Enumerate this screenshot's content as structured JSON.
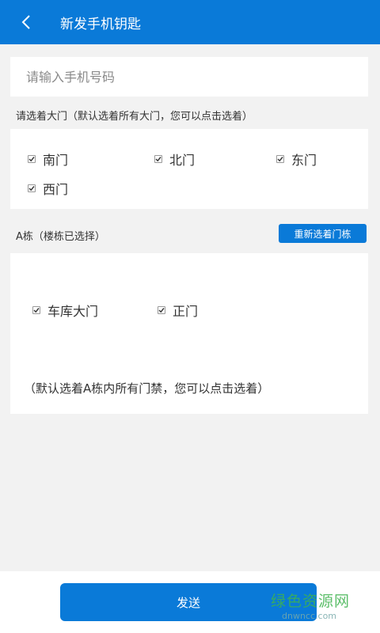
{
  "header": {
    "title": "新发手机钥匙"
  },
  "phone": {
    "placeholder": "请输入手机号码",
    "value": ""
  },
  "gates_section": {
    "label": "请选着大门（默认选着所有大门，您可以点击选着）",
    "items": [
      {
        "label": "南门",
        "checked": true
      },
      {
        "label": "北门",
        "checked": true
      },
      {
        "label": "东门",
        "checked": true
      },
      {
        "label": "西门",
        "checked": true
      }
    ]
  },
  "building_section": {
    "label": "A栋（楼栋已选择）",
    "reselect_label": "重新选着门栋",
    "doors": [
      {
        "label": "车库大门",
        "checked": true
      },
      {
        "label": "正门",
        "checked": true
      }
    ],
    "note": "（默认选着A栋内所有门禁，您可以点击选着）"
  },
  "footer": {
    "send_label": "发送"
  },
  "watermark": {
    "main": "绿色资源网",
    "sub": "dnwncc.com"
  }
}
